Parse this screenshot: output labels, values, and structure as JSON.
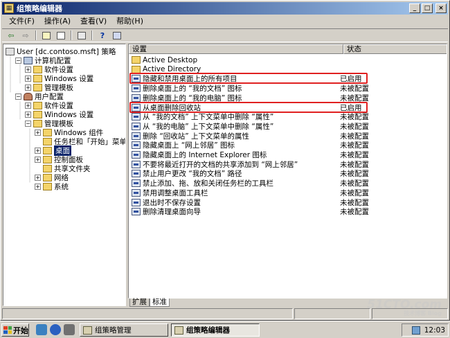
{
  "window": {
    "title": "组策略编辑器",
    "controls": [
      "_",
      "□",
      "×"
    ]
  },
  "menu": [
    "文件(F)",
    "操作(A)",
    "查看(V)",
    "帮助(H)"
  ],
  "tree": [
    {
      "label": "User [dc.contoso.msft] 策略",
      "icon": "policy-icon",
      "level": 0,
      "expander": ""
    },
    {
      "label": "计算机配置",
      "icon": "computer-icon",
      "level": 1,
      "expander": "−"
    },
    {
      "label": "软件设置",
      "icon": "folder-icon",
      "level": 2,
      "expander": "+"
    },
    {
      "label": "Windows 设置",
      "icon": "folder-icon",
      "level": 2,
      "expander": "+"
    },
    {
      "label": "管理模板",
      "icon": "folder-icon",
      "level": 2,
      "expander": "+"
    },
    {
      "label": "用户配置",
      "icon": "user-icon",
      "level": 1,
      "expander": "−"
    },
    {
      "label": "软件设置",
      "icon": "folder-icon",
      "level": 2,
      "expander": "+"
    },
    {
      "label": "Windows 设置",
      "icon": "folder-icon",
      "level": 2,
      "expander": "+"
    },
    {
      "label": "管理模板",
      "icon": "folder-icon",
      "level": 2,
      "expander": "−"
    },
    {
      "label": "Windows 组件",
      "icon": "folder-icon",
      "level": 3,
      "expander": "+"
    },
    {
      "label": "任务栏和「开始」菜单",
      "icon": "folder-icon",
      "level": 3,
      "expander": ""
    },
    {
      "label": "桌面",
      "icon": "folder-icon",
      "level": 3,
      "expander": "+",
      "selected": true
    },
    {
      "label": "控制面板",
      "icon": "folder-icon",
      "level": 3,
      "expander": "+"
    },
    {
      "label": "共享文件夹",
      "icon": "folder-icon",
      "level": 3,
      "expander": ""
    },
    {
      "label": "网络",
      "icon": "folder-icon",
      "level": 3,
      "expander": "+"
    },
    {
      "label": "系统",
      "icon": "folder-icon",
      "level": 3,
      "expander": "+"
    }
  ],
  "list": {
    "headers": [
      "设置",
      "状态"
    ],
    "rows": [
      {
        "name": "Active Desktop",
        "state": "",
        "icon": "folder-icon"
      },
      {
        "name": "Active Directory",
        "state": "",
        "icon": "folder-icon"
      },
      {
        "name": "隐藏和禁用桌面上的所有项目",
        "state": "已启用",
        "icon": "setting-icon",
        "highlight": true
      },
      {
        "name": "删除桌面上的 “我的文档” 图标",
        "state": "未被配置",
        "icon": "setting-icon"
      },
      {
        "name": "删除桌面上的 “我的电脑” 图标",
        "state": "未被配置",
        "icon": "setting-icon"
      },
      {
        "name": "从桌面删除回收站",
        "state": "已启用",
        "icon": "setting-icon",
        "highlight": true
      },
      {
        "name": "从 “我的文档” 上下文菜单中删除 “属性”",
        "state": "未被配置",
        "icon": "setting-icon"
      },
      {
        "name": "从 “我的电脑” 上下文菜单中删除 “属性”",
        "state": "未被配置",
        "icon": "setting-icon"
      },
      {
        "name": "删除 “回收站” 上下文菜单的属性",
        "state": "未被配置",
        "icon": "setting-icon"
      },
      {
        "name": "隐藏桌面上 “网上邻居” 图标",
        "state": "未被配置",
        "icon": "setting-icon"
      },
      {
        "name": "隐藏桌面上的 Internet Explorer 图标",
        "state": "未被配置",
        "icon": "setting-icon"
      },
      {
        "name": "不要将最近打开的文档的共享添加到 “网上邻居”",
        "state": "未被配置",
        "icon": "setting-icon"
      },
      {
        "name": "禁止用户更改 “我的文档” 路径",
        "state": "未被配置",
        "icon": "setting-icon"
      },
      {
        "name": "禁止添加、拖、放和关闭任务栏的工具栏",
        "state": "未被配置",
        "icon": "setting-icon"
      },
      {
        "name": "禁用调整桌面工具栏",
        "state": "未被配置",
        "icon": "setting-icon"
      },
      {
        "name": "退出时不保存设置",
        "state": "未被配置",
        "icon": "setting-icon"
      },
      {
        "name": "删除清理桌面向导",
        "state": "未被配置",
        "icon": "setting-icon"
      }
    ]
  },
  "tabs": [
    "扩展",
    "标准"
  ],
  "taskbar": {
    "start_label": "开始",
    "buttons": [
      "组策略管理",
      "组策略编辑器"
    ],
    "clock": "12:03"
  },
  "watermark": {
    "main": "51CTO.com",
    "sub": "技术博客 Blog"
  }
}
